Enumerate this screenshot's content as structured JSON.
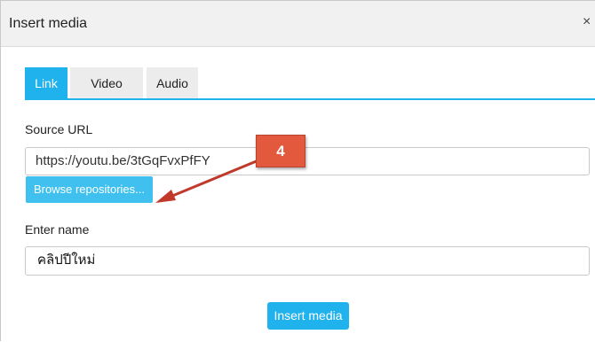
{
  "dialog": {
    "title": "Insert media",
    "close_glyph": "×"
  },
  "tabs": [
    {
      "label": "Link",
      "active": true
    },
    {
      "label": "Video",
      "active": false
    },
    {
      "label": "Audio",
      "active": false
    }
  ],
  "source_url": {
    "label": "Source URL",
    "value": "https://youtu.be/3tGqFvxPfFY"
  },
  "browse_button": {
    "label": "Browse repositories..."
  },
  "enter_name": {
    "label": "Enter name",
    "value": "คลิปปีใหม่"
  },
  "insert_button": {
    "label": "Insert media"
  },
  "annotation": {
    "step": "4"
  },
  "colors": {
    "accent": "#1fb2ec",
    "browse_button": "#3fc0ef",
    "annotation": "#e2593d",
    "arrow": "#c0392b"
  },
  "icons": {
    "close": "close-icon"
  }
}
